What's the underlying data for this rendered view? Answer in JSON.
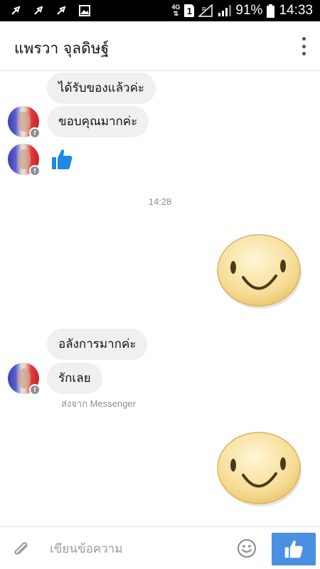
{
  "status_bar": {
    "network": "4G",
    "sim": "1",
    "signal_roaming": "R",
    "battery": "91%",
    "time": "14:33"
  },
  "header": {
    "title": "แพรวา จุลดิษฐ์"
  },
  "messages": {
    "received_1": "ได้รับของแล้วค่ะ",
    "received_2": "ขอบคุณมากค่ะ",
    "timestamp": "14:28",
    "received_3": "อลังการมากค่ะ",
    "received_4": "รักเลย",
    "sent_via": "ส่งจาก Messenger"
  },
  "composer": {
    "placeholder": "เขียนข้อความ"
  },
  "colors": {
    "accent": "#4a90e2",
    "like_blue": "#1e88e5",
    "bubble_bg": "#f0f0f0"
  }
}
